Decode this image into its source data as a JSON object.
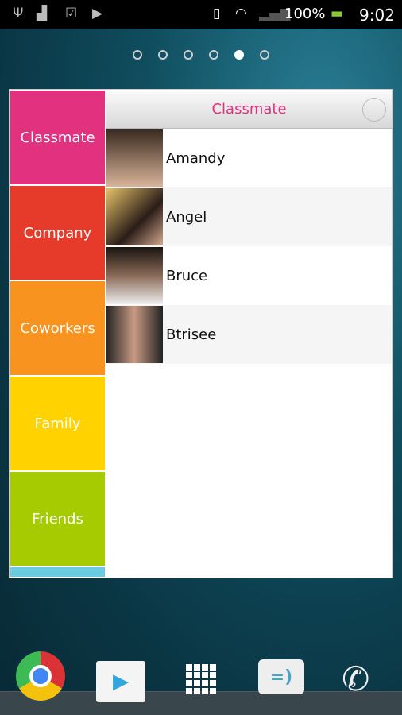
{
  "status_bar": {
    "battery": "100%",
    "time": "9:02",
    "icons": [
      "usb-icon",
      "android-debug-icon",
      "store-update-icon",
      "play-store-icon",
      "sim-missing-icon",
      "wifi-icon",
      "signal-icon",
      "battery-charging-icon"
    ]
  },
  "page_indicator": {
    "pages": 6,
    "active": 5
  },
  "widget": {
    "groups": [
      {
        "label": "Classmate",
        "color": "#e2317f"
      },
      {
        "label": "Company",
        "color": "#e63b2a"
      },
      {
        "label": "Coworkers",
        "color": "#f7931e"
      },
      {
        "label": "Family",
        "color": "#ffd200"
      },
      {
        "label": "Friends",
        "color": "#a6cc00"
      },
      {
        "label": "",
        "color": "#6ccbe0"
      }
    ],
    "header_title": "Classmate",
    "header_color": "#e2317f",
    "contacts": [
      {
        "name": "Amandy"
      },
      {
        "name": "Angel"
      },
      {
        "name": "Bruce"
      },
      {
        "name": "Btrisee"
      }
    ]
  },
  "dock": [
    "chrome-icon",
    "play-store-icon",
    "app-drawer-icon",
    "messaging-icon",
    "phone-icon"
  ]
}
